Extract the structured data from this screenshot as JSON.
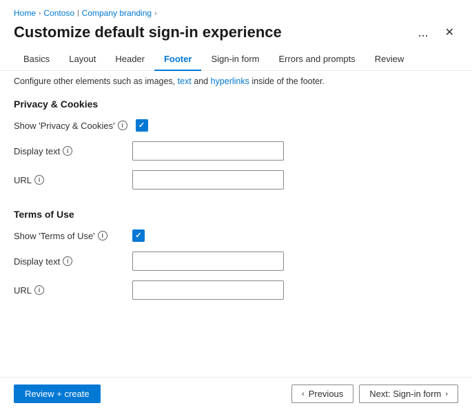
{
  "breadcrumb": {
    "items": [
      "Home",
      "Contoso",
      "Company branding"
    ]
  },
  "page": {
    "title": "Customize default sign-in experience",
    "ellipsis_label": "...",
    "close_label": "✕"
  },
  "tabs": [
    {
      "id": "basics",
      "label": "Basics",
      "active": false
    },
    {
      "id": "layout",
      "label": "Layout",
      "active": false
    },
    {
      "id": "header",
      "label": "Header",
      "active": false
    },
    {
      "id": "footer",
      "label": "Footer",
      "active": true
    },
    {
      "id": "sign-in-form",
      "label": "Sign-in form",
      "active": false
    },
    {
      "id": "errors-prompts",
      "label": "Errors and prompts",
      "active": false
    },
    {
      "id": "review",
      "label": "Review",
      "active": false
    }
  ],
  "info_bar": {
    "text_before": "Configure other elements such as images, ",
    "link1": "text",
    "text_mid": " and ",
    "link2": "hyperlinks",
    "text_after": " inside of the footer."
  },
  "privacy_section": {
    "title": "Privacy & Cookies",
    "show_label": "Show 'Privacy & Cookies'",
    "show_checked": true,
    "display_text_label": "Display text",
    "display_text_value": "",
    "display_text_placeholder": "",
    "url_label": "URL",
    "url_value": "",
    "url_placeholder": ""
  },
  "terms_section": {
    "title": "Terms of Use",
    "show_label": "Show 'Terms of Use'",
    "show_checked": true,
    "display_text_label": "Display text",
    "display_text_value": "",
    "display_text_placeholder": "",
    "url_label": "URL",
    "url_value": "",
    "url_placeholder": ""
  },
  "footer": {
    "review_create_label": "Review + create",
    "previous_label": "Previous",
    "next_label": "Next: Sign-in form"
  }
}
